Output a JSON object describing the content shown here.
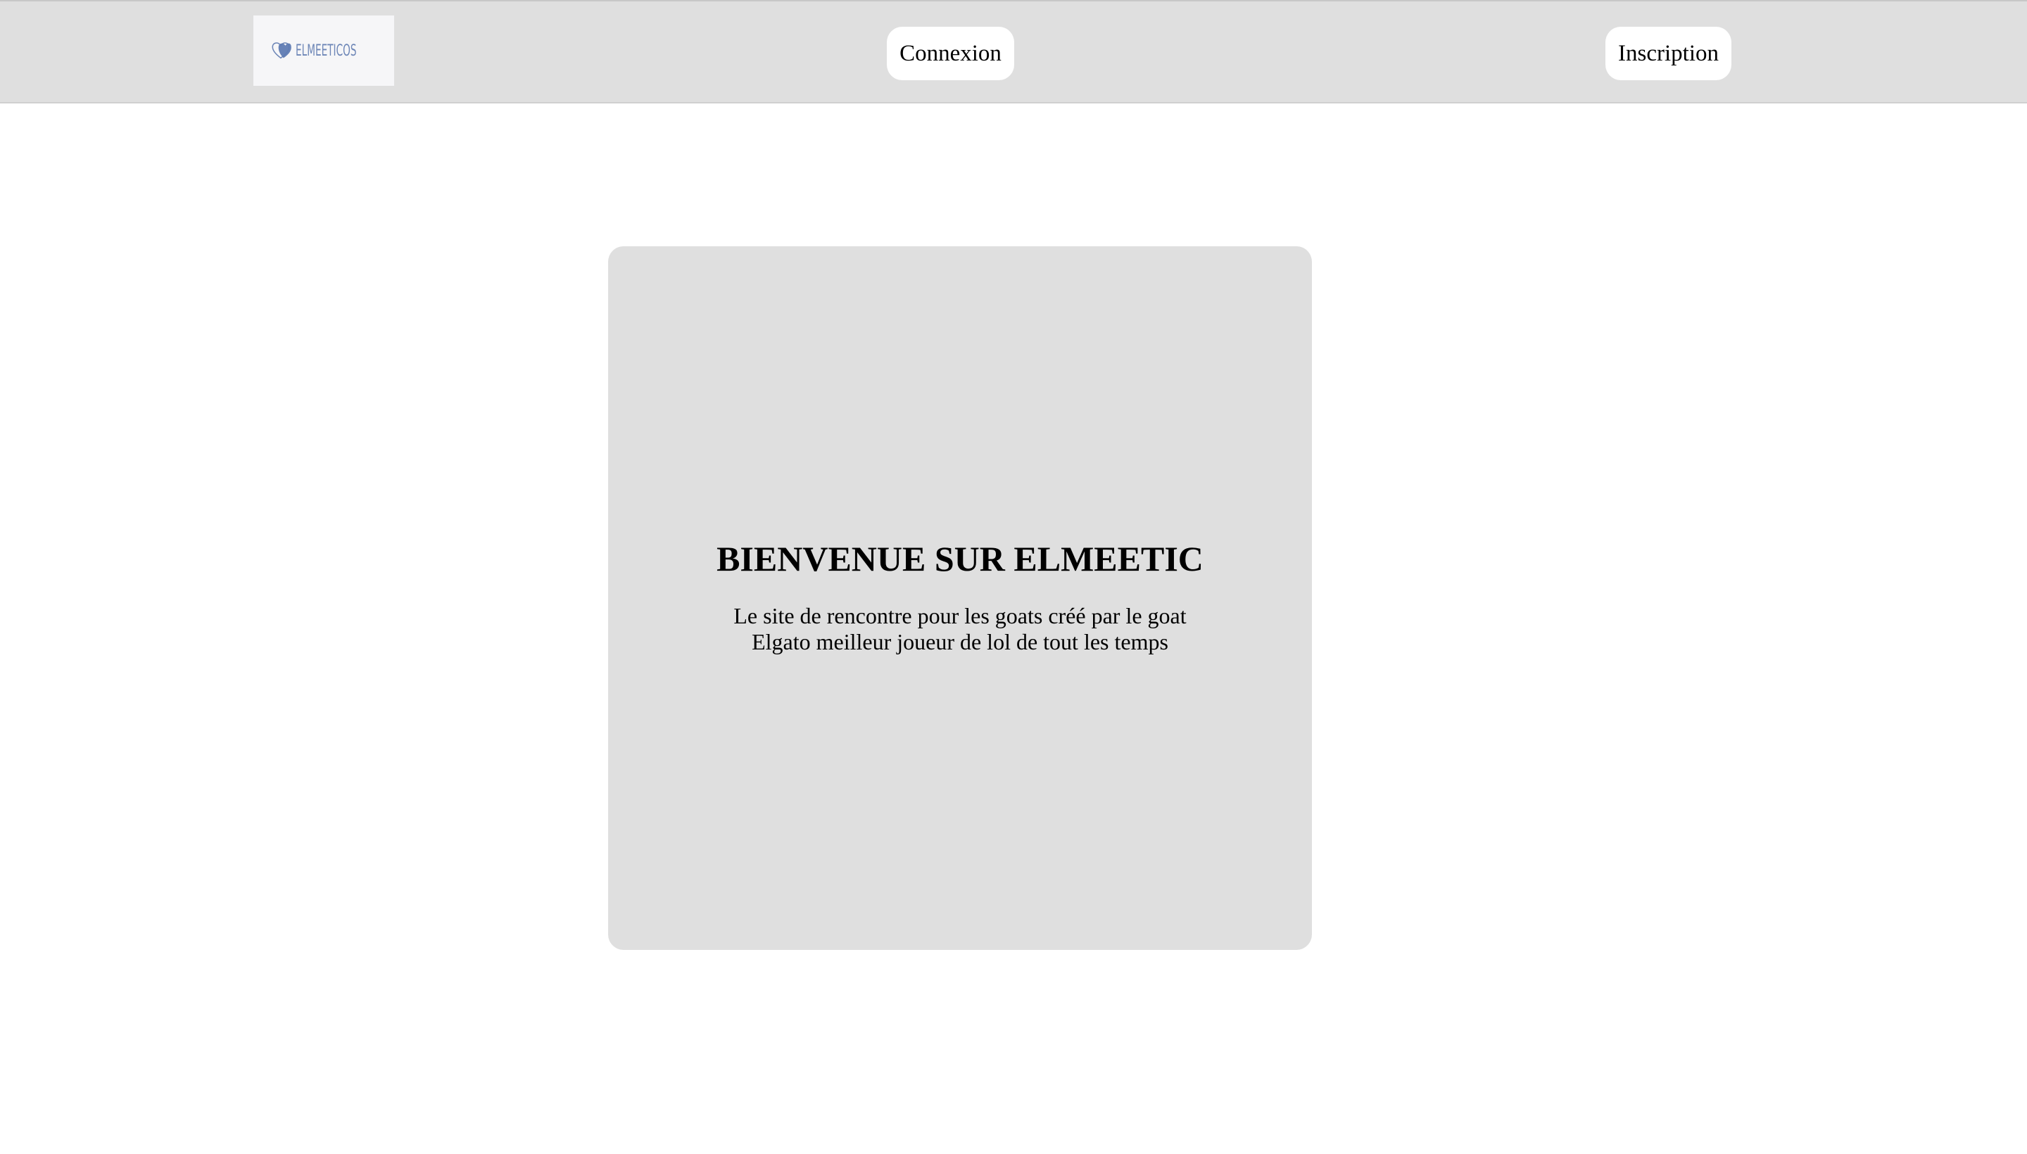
{
  "header": {
    "logo": {
      "text": "ELMEETICOS",
      "icon": "double-heart-icon",
      "color": "#6d86b7"
    },
    "login_label": "Connexion",
    "signup_label": "Inscription",
    "background": "#dfdfdf"
  },
  "main": {
    "card": {
      "title": "BIENVENUE SUR ELMEETIC",
      "line1": "Le site de rencontre pour les goats créé par le goat",
      "line2": "Elgato meilleur joueur de lol de tout les temps",
      "background": "#dfdfdf"
    }
  }
}
